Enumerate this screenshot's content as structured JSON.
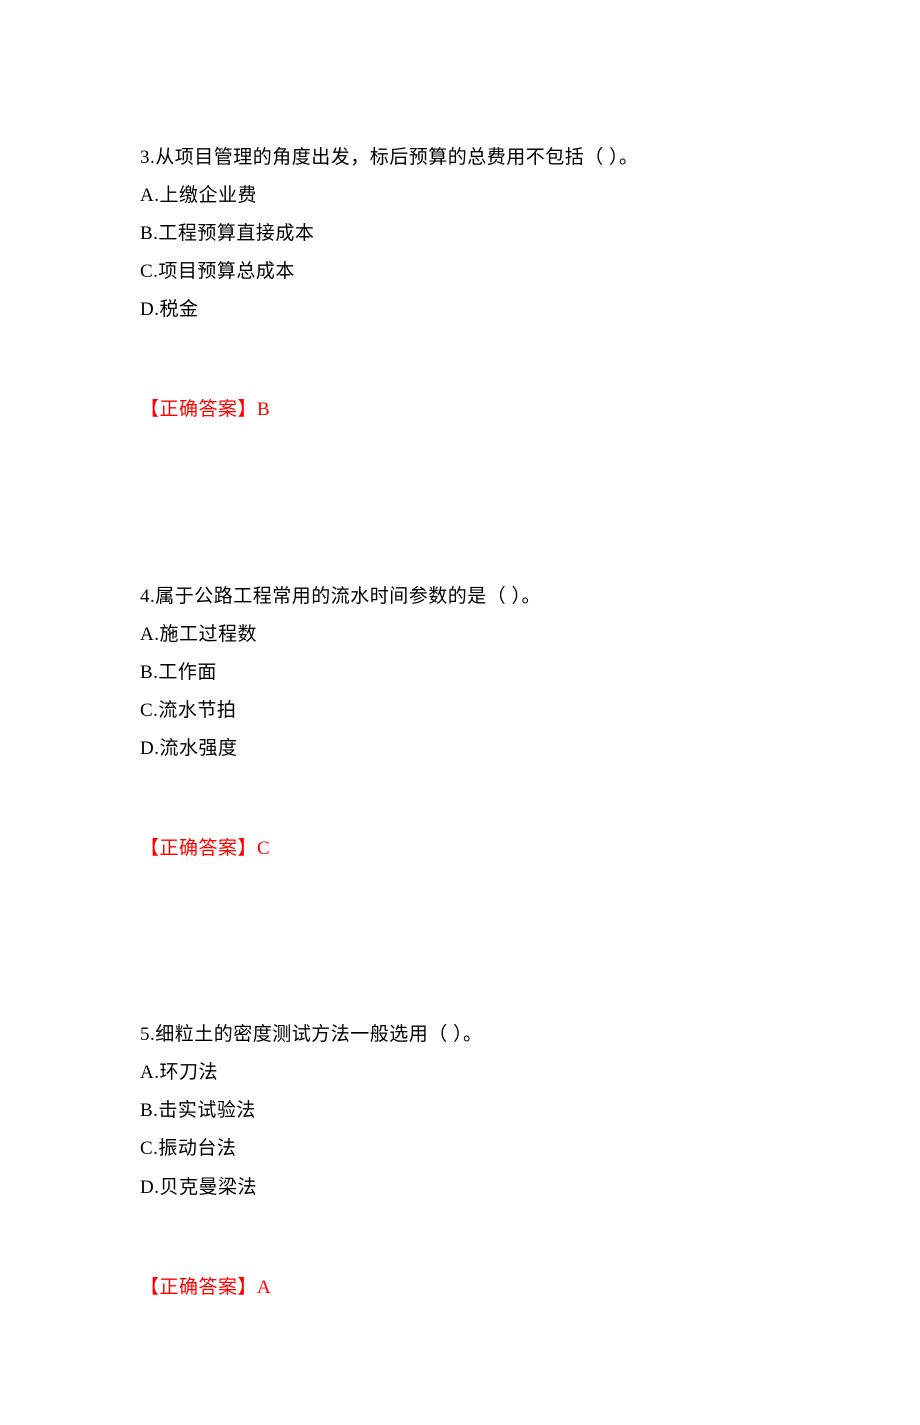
{
  "answer_label": "【正确答案】",
  "questions": [
    {
      "number": "3",
      "prompt": "3.从项目管理的角度出发，标后预算的总费用不包括（  ）。",
      "options": {
        "A": "A.上缴企业费",
        "B": "B.工程预算直接成本",
        "C": "C.项目预算总成本",
        "D": "D.税金"
      },
      "answer": "B"
    },
    {
      "number": "4",
      "prompt": "4.属于公路工程常用的流水时间参数的是（  ）。",
      "options": {
        "A": "A.施工过程数",
        "B": "B.工作面",
        "C": "C.流水节拍",
        "D": "D.流水强度"
      },
      "answer": "C"
    },
    {
      "number": "5",
      "prompt": "5.细粒土的密度测试方法一般选用（  ）。",
      "options": {
        "A": "A.环刀法",
        "B": "B.击实试验法",
        "C": "C.振动台法",
        "D": "D.贝克曼梁法"
      },
      "answer": "A"
    }
  ]
}
